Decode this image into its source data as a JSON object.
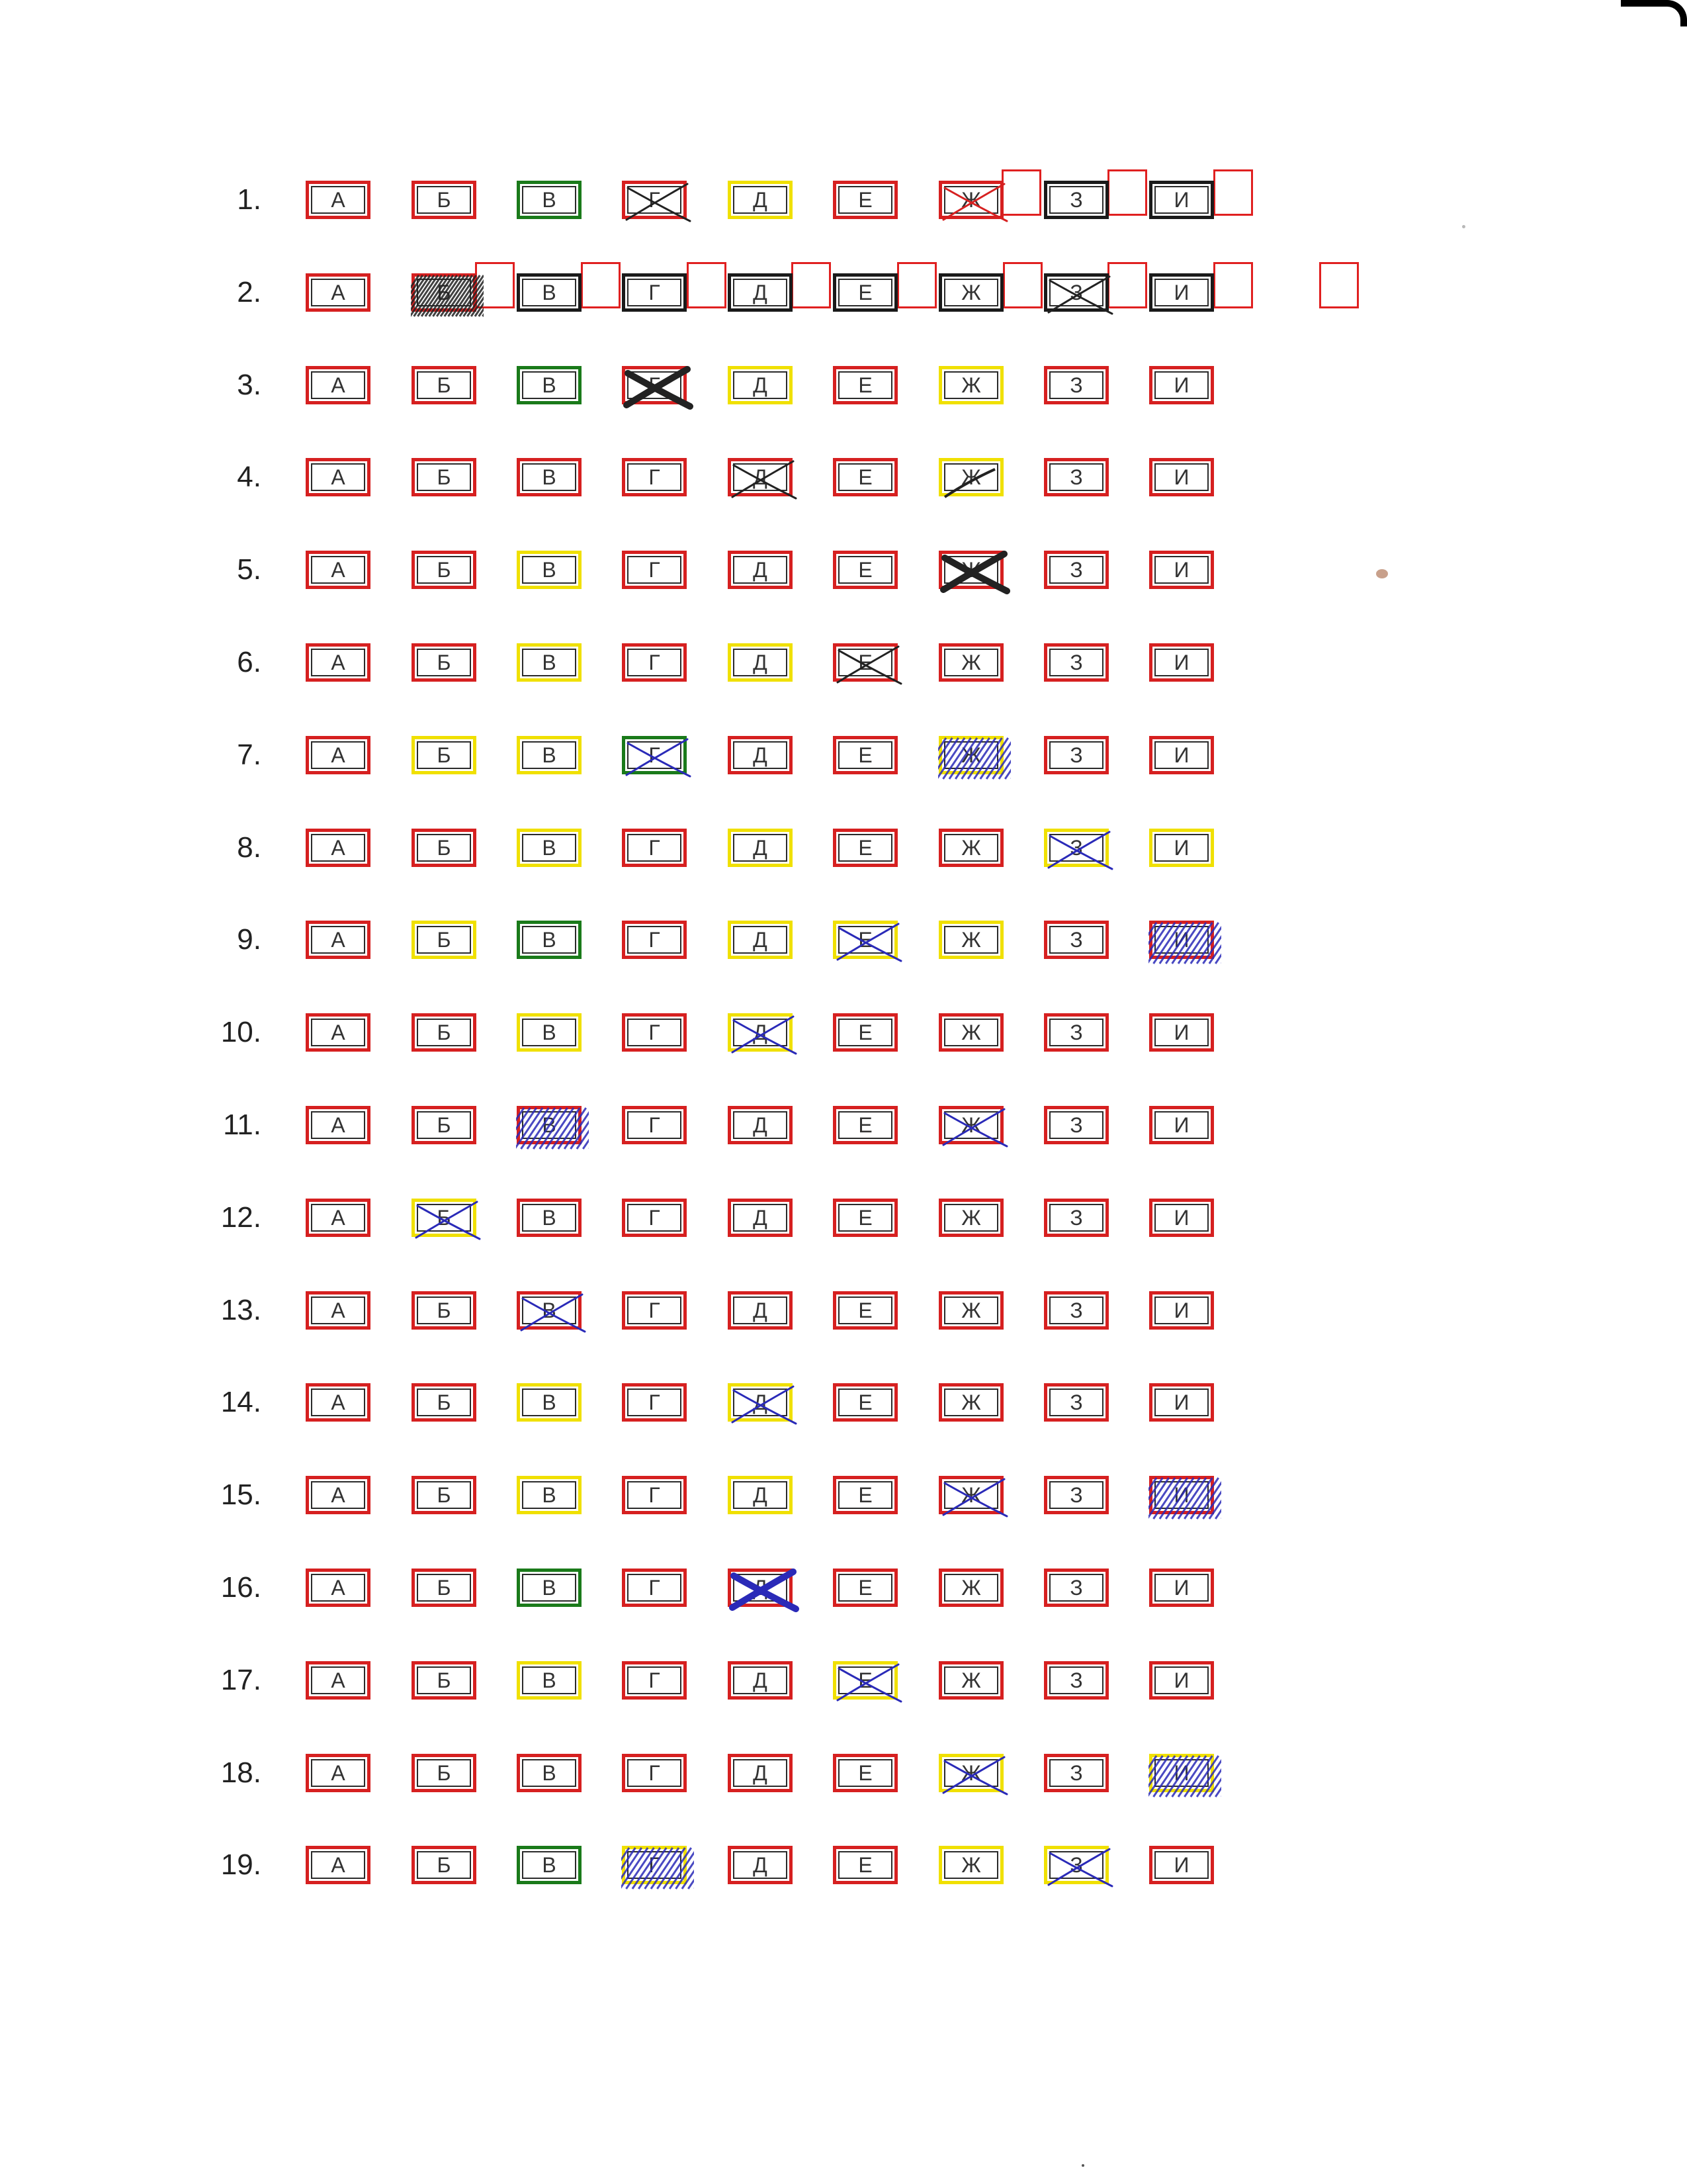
{
  "colors": {
    "red": "#d62020",
    "green": "#1a7a1a",
    "yellow": "#f0e000",
    "black": "#1a1a1a",
    "blue_ink": "#2a2ab8",
    "pencil": "#222222"
  },
  "letters": [
    "А",
    "Б",
    "В",
    "Г",
    "Д",
    "Е",
    "Ж",
    "З",
    "И"
  ],
  "questions": [
    {
      "number": "1.",
      "borders": [
        "red",
        "red",
        "green",
        "red",
        "yellow",
        "red",
        "red",
        "black",
        "black"
      ],
      "marks": [
        null,
        null,
        null,
        "x-pencil",
        null,
        null,
        "x-red",
        null,
        null
      ],
      "extra_small_boxes": [
        7,
        8,
        9
      ]
    },
    {
      "number": "2.",
      "borders": [
        "red",
        "red",
        "black",
        "black",
        "black",
        "black",
        "black",
        "black",
        "black"
      ],
      "marks": [
        null,
        "scribble-pencil",
        null,
        null,
        null,
        null,
        null,
        "x-pencil",
        null
      ],
      "extra_small_boxes": [
        2,
        3,
        4,
        5,
        6,
        7,
        8,
        9,
        10
      ]
    },
    {
      "number": "3.",
      "borders": [
        "red",
        "red",
        "green",
        "red",
        "yellow",
        "red",
        "yellow",
        "red",
        "red"
      ],
      "marks": [
        null,
        null,
        null,
        "x-pencil-bold",
        null,
        null,
        null,
        null,
        null
      ]
    },
    {
      "number": "4.",
      "borders": [
        "red",
        "red",
        "red",
        "red",
        "red",
        "red",
        "yellow",
        "red",
        "red"
      ],
      "marks": [
        null,
        null,
        null,
        null,
        "x-pencil",
        null,
        "slash-pencil",
        null,
        null
      ]
    },
    {
      "number": "5.",
      "borders": [
        "red",
        "red",
        "yellow",
        "red",
        "red",
        "red",
        "red",
        "red",
        "red"
      ],
      "marks": [
        null,
        null,
        null,
        null,
        null,
        null,
        "x-pencil-bold",
        null,
        null
      ]
    },
    {
      "number": "6.",
      "borders": [
        "red",
        "red",
        "yellow",
        "red",
        "yellow",
        "red",
        "red",
        "red",
        "red"
      ],
      "marks": [
        null,
        null,
        null,
        null,
        null,
        "x-pencil",
        null,
        null,
        null
      ]
    },
    {
      "number": "7.",
      "borders": [
        "red",
        "yellow",
        "yellow",
        "green",
        "red",
        "red",
        "yellow",
        "red",
        "red"
      ],
      "marks": [
        null,
        null,
        null,
        "x-blue",
        null,
        null,
        "hatch-blue",
        null,
        null
      ]
    },
    {
      "number": "8.",
      "borders": [
        "red",
        "red",
        "yellow",
        "red",
        "yellow",
        "red",
        "red",
        "yellow",
        "yellow"
      ],
      "marks": [
        null,
        null,
        null,
        null,
        null,
        null,
        null,
        "x-blue",
        null
      ]
    },
    {
      "number": "9.",
      "borders": [
        "red",
        "yellow",
        "green",
        "red",
        "yellow",
        "yellow",
        "yellow",
        "red",
        "red"
      ],
      "marks": [
        null,
        null,
        null,
        null,
        null,
        "x-blue",
        null,
        null,
        "hatch-blue"
      ]
    },
    {
      "number": "10.",
      "borders": [
        "red",
        "red",
        "yellow",
        "red",
        "yellow",
        "red",
        "red",
        "red",
        "red"
      ],
      "marks": [
        null,
        null,
        null,
        null,
        "x-blue",
        null,
        null,
        null,
        null
      ]
    },
    {
      "number": "11.",
      "borders": [
        "red",
        "red",
        "red",
        "red",
        "red",
        "red",
        "red",
        "red",
        "red"
      ],
      "marks": [
        null,
        null,
        "hatch-blue",
        null,
        null,
        null,
        "x-blue",
        null,
        null
      ]
    },
    {
      "number": "12.",
      "borders": [
        "red",
        "yellow",
        "red",
        "red",
        "red",
        "red",
        "red",
        "red",
        "red"
      ],
      "marks": [
        null,
        "x-blue",
        null,
        null,
        null,
        null,
        null,
        null,
        null
      ]
    },
    {
      "number": "13.",
      "borders": [
        "red",
        "red",
        "red",
        "red",
        "red",
        "red",
        "red",
        "red",
        "red"
      ],
      "marks": [
        null,
        null,
        "x-blue",
        null,
        null,
        null,
        null,
        null,
        null
      ]
    },
    {
      "number": "14.",
      "borders": [
        "red",
        "red",
        "yellow",
        "red",
        "yellow",
        "red",
        "red",
        "red",
        "red"
      ],
      "marks": [
        null,
        null,
        null,
        null,
        "x-blue",
        null,
        null,
        null,
        null
      ]
    },
    {
      "number": "15.",
      "borders": [
        "red",
        "red",
        "yellow",
        "red",
        "yellow",
        "red",
        "red",
        "red",
        "red"
      ],
      "marks": [
        null,
        null,
        null,
        null,
        null,
        null,
        "x-blue",
        null,
        "hatch-blue"
      ]
    },
    {
      "number": "16.",
      "borders": [
        "red",
        "red",
        "green",
        "red",
        "red",
        "red",
        "red",
        "red",
        "red"
      ],
      "marks": [
        null,
        null,
        null,
        null,
        "x-blue-bold",
        null,
        null,
        null,
        null
      ]
    },
    {
      "number": "17.",
      "borders": [
        "red",
        "red",
        "yellow",
        "red",
        "red",
        "yellow",
        "red",
        "red",
        "red"
      ],
      "marks": [
        null,
        null,
        null,
        null,
        null,
        "x-blue",
        null,
        null,
        null
      ]
    },
    {
      "number": "18.",
      "borders": [
        "red",
        "red",
        "red",
        "red",
        "red",
        "red",
        "yellow",
        "red",
        "yellow"
      ],
      "marks": [
        null,
        null,
        null,
        null,
        null,
        null,
        "x-blue",
        null,
        "hatch-blue"
      ]
    },
    {
      "number": "19.",
      "borders": [
        "red",
        "red",
        "green",
        "yellow",
        "red",
        "red",
        "yellow",
        "yellow",
        "red"
      ],
      "marks": [
        null,
        null,
        null,
        "hatch-blue",
        null,
        null,
        null,
        "x-blue",
        null
      ]
    }
  ]
}
